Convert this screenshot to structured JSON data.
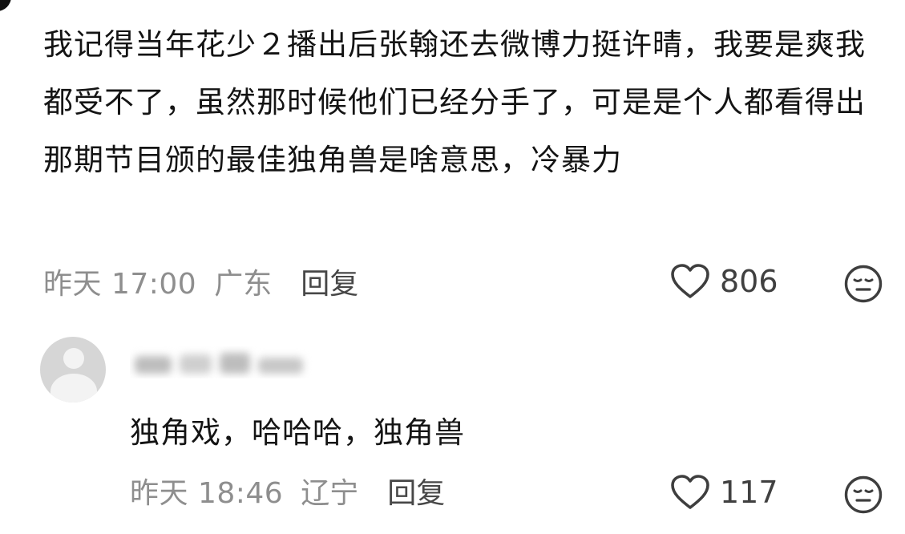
{
  "comment": {
    "text": "我记得当年花少２播出后张翰还去微博力挺许晴，我要是爽我都受不了，虽然那时候他们已经分手了，可是是个人都看得出那期节目颁的最佳独角兽是啥意思，冷暴力",
    "time": "昨天 17:00",
    "location": "广东",
    "reply_label": "回复",
    "likes": "806",
    "like_icon": "heart-outline-icon",
    "reaction_icon": "neutral-face-icon"
  },
  "reply": {
    "text": "独角戏，哈哈哈，独角兽",
    "time": "昨天 18:46",
    "location": "辽宁",
    "reply_label": "回复",
    "likes": "117",
    "like_icon": "heart-outline-icon",
    "reaction_icon": "neutral-face-icon"
  },
  "colors": {
    "text": "#141414",
    "meta": "#8e8e8e",
    "reply_action": "#474747",
    "background": "#ffffff"
  }
}
